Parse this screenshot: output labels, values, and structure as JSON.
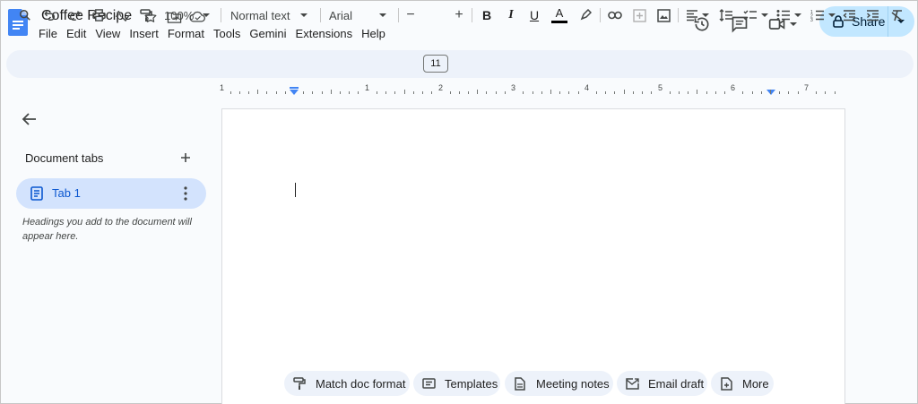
{
  "doc": {
    "title": "Coffee Recipe"
  },
  "menu": [
    "File",
    "Edit",
    "View",
    "Insert",
    "Format",
    "Tools",
    "Gemini",
    "Extensions",
    "Help"
  ],
  "share": {
    "label": "Share"
  },
  "toolbar": {
    "zoom": "100%",
    "style": "Normal text",
    "font": "Arial",
    "font_size": "11"
  },
  "ruler": {
    "labels": [
      "1",
      "1",
      "2",
      "3",
      "4",
      "5",
      "6",
      "7"
    ]
  },
  "sidebar": {
    "heading": "Document tabs",
    "tab_label": "Tab 1",
    "hint": "Headings you add to the document will appear here."
  },
  "chips": [
    {
      "label": "Match doc format",
      "icon": "paint-format-icon"
    },
    {
      "label": "Templates",
      "icon": "templates-icon"
    },
    {
      "label": "Meeting notes",
      "icon": "document-icon"
    },
    {
      "label": "Email draft",
      "icon": "email-draft-icon"
    },
    {
      "label": "More",
      "icon": "more-add-icon"
    }
  ],
  "colors": {
    "accent": "#0b57d0",
    "share_bg": "#c2e7ff",
    "toolbar_bg": "#edf2fa",
    "tab_active_bg": "#d3e3fd",
    "doc_logo": "#4285f4"
  }
}
